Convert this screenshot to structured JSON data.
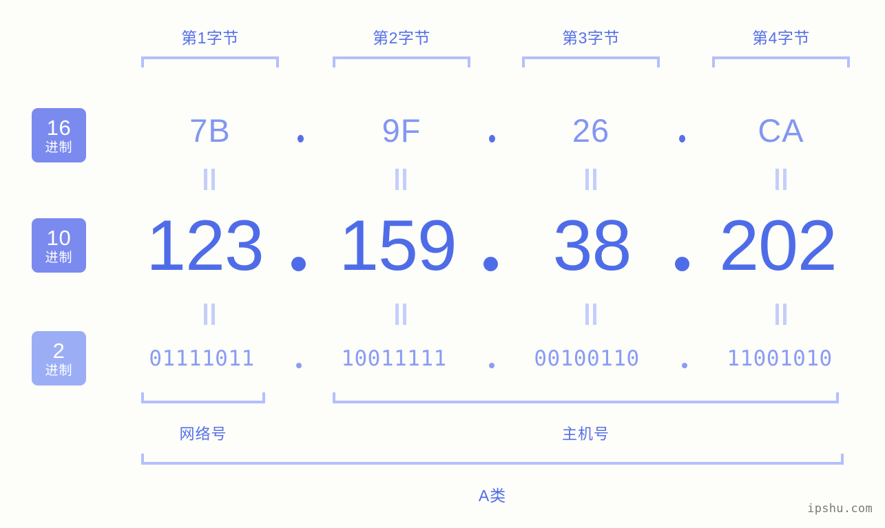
{
  "meta": {
    "watermark": "ipshu.com"
  },
  "byte_headers": [
    {
      "label": "第1字节"
    },
    {
      "label": "第2字节"
    },
    {
      "label": "第3字节"
    },
    {
      "label": "第4字节"
    }
  ],
  "radix_badges": [
    {
      "num": "16",
      "unit": "进制",
      "color": "#7B8AEE"
    },
    {
      "num": "10",
      "unit": "进制",
      "color": "#7B8AEE"
    },
    {
      "num": "2",
      "unit": "进制",
      "color": "#9BAEF5"
    }
  ],
  "rows": {
    "hex": {
      "values": [
        "7B",
        "9F",
        "26",
        "CA"
      ],
      "separator": ".",
      "color": "#8296F2"
    },
    "decimal": {
      "values": [
        "123",
        "159",
        "38",
        "202"
      ],
      "separator": ".",
      "color": "#4F6CE8"
    },
    "binary": {
      "values": [
        "01111011",
        "10011111",
        "00100110",
        "11001010"
      ],
      "separator": ".",
      "color": "#8A9CF3"
    }
  },
  "equals_marks": {
    "symbol": "=",
    "hex_to_dec_count": 4,
    "dec_to_bin_count": 4,
    "color": "#C5CEFA"
  },
  "address": {
    "decimal_full": "123.159.38.202",
    "hex_full": "7B.9F.26.CA",
    "binary_full": "01111011.10011111.00100110.11001010"
  },
  "segments": [
    {
      "name": "网络号",
      "bytes": [
        1
      ]
    },
    {
      "name": "主机号",
      "bytes": [
        2,
        3,
        4
      ]
    }
  ],
  "ip_class": {
    "label": "A类"
  },
  "colors": {
    "background": "#FDFDFA",
    "accent_strong": "#4F6CE8",
    "accent_medium": "#7B8AEE",
    "accent_light": "#9BAEF5",
    "bracket": "#B4C0FA",
    "equals": "#C5CEFA",
    "watermark": "#7A7A7A"
  }
}
